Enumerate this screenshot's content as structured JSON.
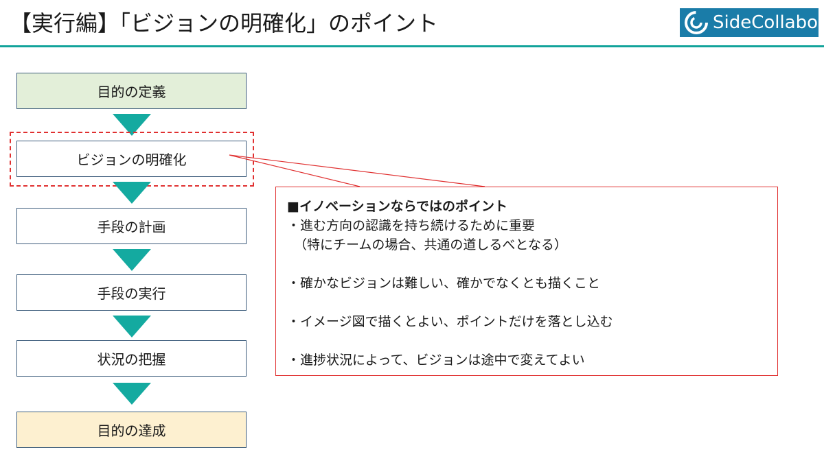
{
  "header": {
    "title": "【実行編】「ビジョンの明確化」のポイント",
    "logo_text": "SideCollabo"
  },
  "flow": {
    "steps": [
      {
        "label": "目的の定義"
      },
      {
        "label": "ビジョンの明確化"
      },
      {
        "label": "手段の計画"
      },
      {
        "label": "手段の実行"
      },
      {
        "label": "状況の把握"
      },
      {
        "label": "目的の達成"
      }
    ]
  },
  "callout": {
    "heading": "■イノベーションならではのポイント",
    "points": [
      "・進む方向の認識を持ち続けるために重要",
      "（特にチームの場合、共通の道しるべとなる）",
      "・確かなビジョンは難しい、確かでなくとも描くこと",
      "・イメージ図で描くとよい、ポイントだけを落とし込む",
      "・進捗状況によって、ビジョンは途中で変えてよい"
    ]
  },
  "colors": {
    "accent": "#12a39a",
    "arrow": "#14aaa0",
    "highlight": "#e03030",
    "logo_bg": "#1a7ca8",
    "start_fill": "#e3efd9",
    "end_fill": "#fdf0d0"
  }
}
